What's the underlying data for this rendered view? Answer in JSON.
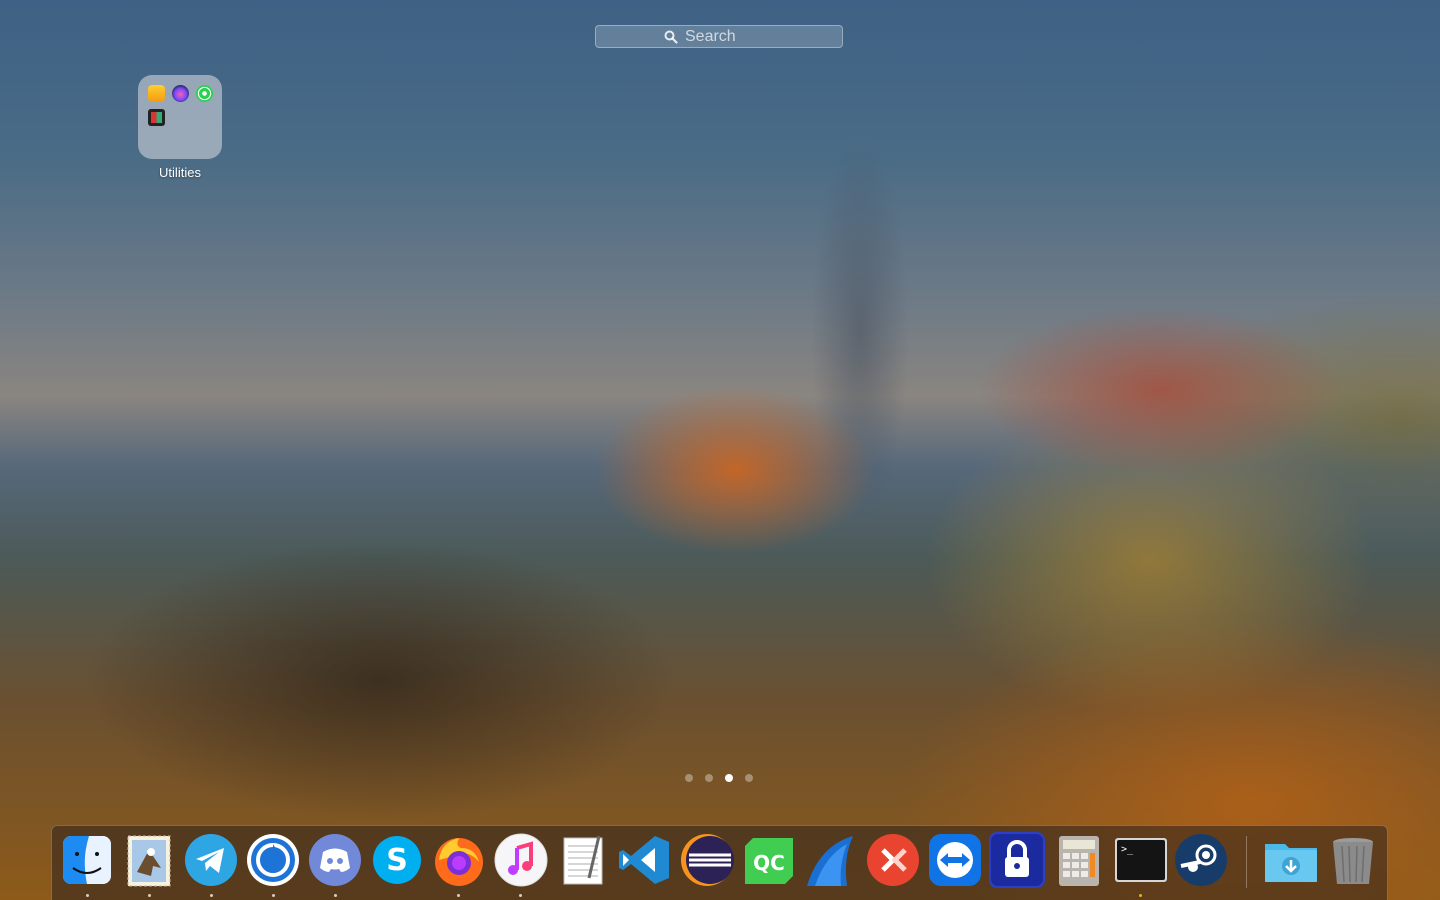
{
  "search": {
    "placeholder": "Search"
  },
  "folder": {
    "label": "Utilities",
    "icons": [
      "home-icon",
      "siri-icon",
      "find-my-icon",
      "photo-booth-icon"
    ]
  },
  "pagination": {
    "total": 4,
    "current": 3
  },
  "dock": {
    "apps": [
      {
        "name": "finder-icon",
        "running": true
      },
      {
        "name": "mail-icon",
        "running": true
      },
      {
        "name": "telegram-icon",
        "running": true
      },
      {
        "name": "mattermost-icon",
        "running": true
      },
      {
        "name": "discord-icon",
        "running": true
      },
      {
        "name": "skype-icon",
        "running": false
      },
      {
        "name": "firefox-icon",
        "running": true
      },
      {
        "name": "itunes-icon",
        "running": true
      },
      {
        "name": "textedit-icon",
        "running": false
      },
      {
        "name": "vscode-icon",
        "running": false
      },
      {
        "name": "eclipse-icon",
        "running": false
      },
      {
        "name": "qt-creator-icon",
        "running": false
      },
      {
        "name": "wireshark-icon",
        "running": false
      },
      {
        "name": "remote-desktop-icon",
        "running": false
      },
      {
        "name": "teamviewer-icon",
        "running": false
      },
      {
        "name": "password-lock-icon",
        "running": false
      },
      {
        "name": "calculator-icon",
        "running": false
      },
      {
        "name": "terminal-icon",
        "running": true
      },
      {
        "name": "steam-icon",
        "running": false
      }
    ],
    "right": [
      {
        "name": "downloads-folder-icon"
      },
      {
        "name": "trash-icon"
      }
    ],
    "terminal_prompt": ">_"
  }
}
